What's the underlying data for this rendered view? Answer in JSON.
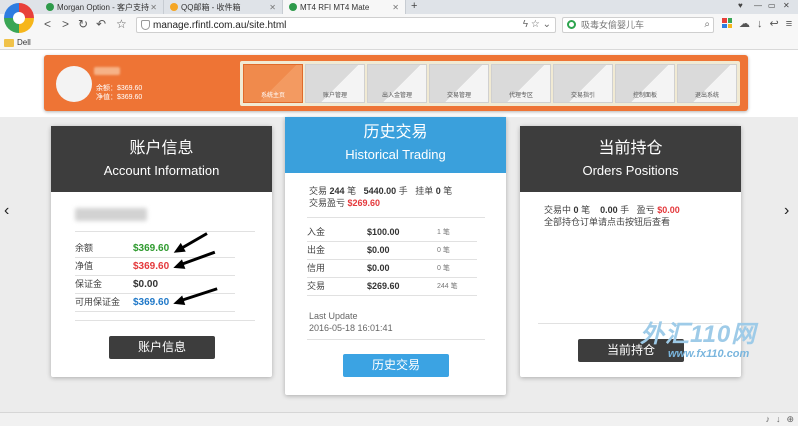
{
  "browser": {
    "tabs": [
      {
        "label": "Morgan Option - 客户支持",
        "icon_color": "#2e9a4a"
      },
      {
        "label": "QQ邮箱 - 收件箱",
        "icon_color": "#f5a623"
      },
      {
        "label": "MT4 RFI MT4 Mate",
        "icon_color": "#2e9a4a"
      }
    ],
    "new_tab": "+",
    "url": "manage.rfintl.com.au/site.html",
    "search_placeholder": "吸毒女偷婴儿车",
    "bookmark_folder": "Dell"
  },
  "header": {
    "balance_line": "余额：$369.60",
    "equity_line": "净值：$369.60",
    "nav": [
      "系统主页",
      "账户管理",
      "出入金管理",
      "交易管理",
      "代理专区",
      "交易指引",
      "控制面板",
      "退出系统"
    ],
    "active_nav_index": 0
  },
  "account_card": {
    "title_cn": "账户信息",
    "title_en": "Account Information",
    "rows": [
      {
        "label": "余额",
        "value": "$369.60",
        "color": "#2e9a2e"
      },
      {
        "label": "净值",
        "value": "$369.60",
        "color": "#e4393c"
      },
      {
        "label": "保证金",
        "value": "$0.00",
        "color": "#333333"
      },
      {
        "label": "可用保证金",
        "value": "$369.60",
        "color": "#1f78c8"
      }
    ],
    "button": "账户信息"
  },
  "history_card": {
    "title_cn": "历史交易",
    "title_en": "Historical Trading",
    "summary": {
      "trades_label": "交易",
      "trades_count": "244",
      "trades_unit": "笔",
      "volume": "5440.00",
      "volume_unit": "手",
      "pending_label": "挂单",
      "pending_count": "0",
      "pending_unit": "笔",
      "pnl_label": "交易盈亏",
      "pnl_value": "$269.60"
    },
    "rows": [
      {
        "label": "入金",
        "amount": "$100.00",
        "count": "1 笔"
      },
      {
        "label": "出金",
        "amount": "$0.00",
        "count": "0 笔"
      },
      {
        "label": "信用",
        "amount": "$0.00",
        "count": "0 笔"
      },
      {
        "label": "交易",
        "amount": "$269.60",
        "count": "244 笔"
      }
    ],
    "last_update_label": "Last Update",
    "last_update_value": "2016-05-18 16:01:41",
    "button": "历史交易"
  },
  "positions_card": {
    "title_cn": "当前持仓",
    "title_en": "Orders Positions",
    "trades_label": "交易中",
    "trades_count": "0",
    "trades_unit": "笔",
    "volume": "0.00",
    "volume_unit": "手",
    "pnl_label": "盈亏",
    "pnl_value": "$0.00",
    "note": "全部持仓订单请点击按钮后查看",
    "button": "当前持仓"
  },
  "watermark": {
    "big": "外汇110网",
    "small": "www.fx110.com"
  }
}
